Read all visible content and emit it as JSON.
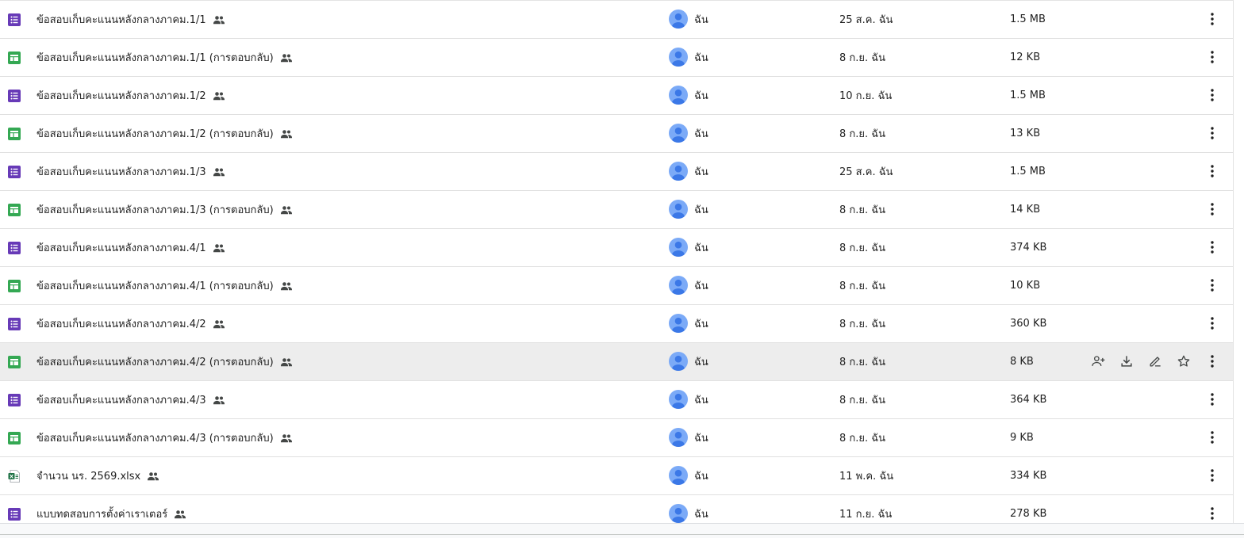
{
  "colors": {
    "forms": "#673ab7",
    "sheets": "#34a853",
    "excel": "#1e7145",
    "avatar": "#7baaf7",
    "avatar_person": "#3b78e7",
    "icon_gray": "#444746"
  },
  "files": [
    {
      "name": "ข้อสอบเก็บคะแนนหลังกลางภาคม.1/1",
      "type": "forms",
      "owner": "ฉัน",
      "modified": "25 ส.ค. ฉัน",
      "size": "1.5 MB"
    },
    {
      "name": "ข้อสอบเก็บคะแนนหลังกลางภาคม.1/1 (การตอบกลับ)",
      "type": "sheets",
      "owner": "ฉัน",
      "modified": "8 ก.ย. ฉัน",
      "size": "12 KB"
    },
    {
      "name": "ข้อสอบเก็บคะแนนหลังกลางภาคม.1/2",
      "type": "forms",
      "owner": "ฉัน",
      "modified": "10 ก.ย. ฉัน",
      "size": "1.5 MB"
    },
    {
      "name": "ข้อสอบเก็บคะแนนหลังกลางภาคม.1/2 (การตอบกลับ)",
      "type": "sheets",
      "owner": "ฉัน",
      "modified": "8 ก.ย. ฉัน",
      "size": "13 KB"
    },
    {
      "name": "ข้อสอบเก็บคะแนนหลังกลางภาคม.1/3",
      "type": "forms",
      "owner": "ฉัน",
      "modified": "25 ส.ค. ฉัน",
      "size": "1.5 MB"
    },
    {
      "name": "ข้อสอบเก็บคะแนนหลังกลางภาคม.1/3 (การตอบกลับ)",
      "type": "sheets",
      "owner": "ฉัน",
      "modified": "8 ก.ย. ฉัน",
      "size": "14 KB"
    },
    {
      "name": "ข้อสอบเก็บคะแนนหลังกลางภาคม.4/1",
      "type": "forms",
      "owner": "ฉัน",
      "modified": "8 ก.ย. ฉัน",
      "size": "374 KB"
    },
    {
      "name": "ข้อสอบเก็บคะแนนหลังกลางภาคม.4/1 (การตอบกลับ)",
      "type": "sheets",
      "owner": "ฉัน",
      "modified": "8 ก.ย. ฉัน",
      "size": "10 KB"
    },
    {
      "name": "ข้อสอบเก็บคะแนนหลังกลางภาคม.4/2",
      "type": "forms",
      "owner": "ฉัน",
      "modified": "8 ก.ย. ฉัน",
      "size": "360 KB"
    },
    {
      "name": "ข้อสอบเก็บคะแนนหลังกลางภาคม.4/2 (การตอบกลับ)",
      "type": "sheets",
      "owner": "ฉัน",
      "modified": "8 ก.ย. ฉัน",
      "size": "8 KB",
      "hover": true
    },
    {
      "name": "ข้อสอบเก็บคะแนนหลังกลางภาคม.4/3",
      "type": "forms",
      "owner": "ฉัน",
      "modified": "8 ก.ย. ฉัน",
      "size": "364 KB"
    },
    {
      "name": "ข้อสอบเก็บคะแนนหลังกลางภาคม.4/3 (การตอบกลับ)",
      "type": "sheets",
      "owner": "ฉัน",
      "modified": "8 ก.ย. ฉัน",
      "size": "9 KB"
    },
    {
      "name": "จำนวน นร. 2569.xlsx",
      "type": "excel",
      "owner": "ฉัน",
      "modified": "11 พ.ค. ฉัน",
      "size": "334 KB"
    },
    {
      "name": "แบบทดสอบการตั้งค่าเราเตอร์",
      "type": "forms",
      "owner": "ฉัน",
      "modified": "11 ก.ย. ฉัน",
      "size": "278 KB"
    }
  ],
  "hover_actions": [
    "share-icon",
    "download-icon",
    "rename-icon",
    "star-icon"
  ]
}
